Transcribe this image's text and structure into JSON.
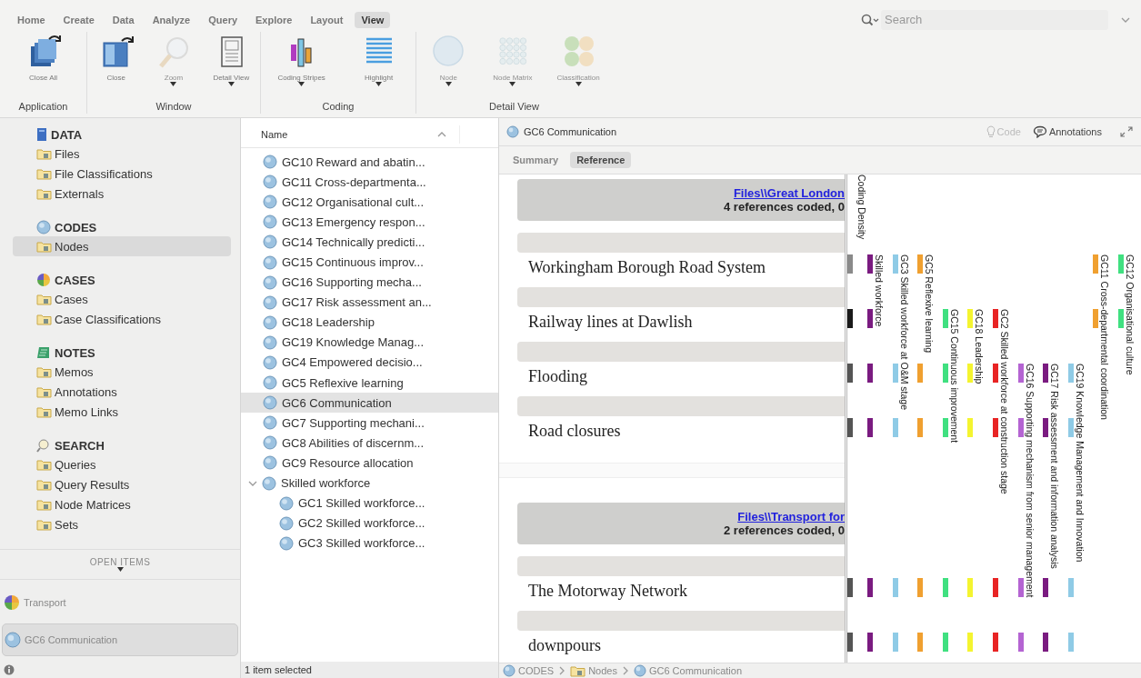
{
  "menu_tabs": [
    {
      "label": "Home",
      "selected": false
    },
    {
      "label": "Create",
      "selected": false
    },
    {
      "label": "Data",
      "selected": false
    },
    {
      "label": "Analyze",
      "selected": false
    },
    {
      "label": "Query",
      "selected": false
    },
    {
      "label": "Explore",
      "selected": false
    },
    {
      "label": "Layout",
      "selected": false
    },
    {
      "label": "View",
      "selected": true
    }
  ],
  "search": {
    "placeholder": "Search"
  },
  "ribbon_groups": [
    {
      "label": "Application",
      "buttons": [
        {
          "label": "Close All",
          "kind": "close-all",
          "disabled": false,
          "dropdown": false
        }
      ]
    },
    {
      "label": "Window",
      "buttons": [
        {
          "label": "Close",
          "kind": "close",
          "disabled": false,
          "dropdown": false
        },
        {
          "label": "Zoom",
          "kind": "zoom",
          "disabled": true,
          "dropdown": true
        },
        {
          "label": "Detail View",
          "kind": "detail-view",
          "disabled": false,
          "dropdown": true
        }
      ]
    },
    {
      "label": "Coding",
      "buttons": [
        {
          "label": "Coding Stripes",
          "kind": "coding-stripes",
          "disabled": false,
          "dropdown": true
        },
        {
          "label": "Highlight",
          "kind": "highlight",
          "disabled": false,
          "dropdown": true
        }
      ]
    },
    {
      "label": "Detail View",
      "buttons": [
        {
          "label": "Node",
          "kind": "node",
          "disabled": true,
          "dropdown": true
        },
        {
          "label": "Node Matrix",
          "kind": "node-matrix",
          "disabled": true,
          "dropdown": true
        },
        {
          "label": "Classification",
          "kind": "classification",
          "disabled": true,
          "dropdown": true
        }
      ]
    }
  ],
  "sidebar": {
    "sections": [
      {
        "label": "DATA",
        "kind": "data",
        "items": [
          {
            "label": "Files",
            "selected": false
          },
          {
            "label": "File Classifications",
            "selected": false
          },
          {
            "label": "Externals",
            "selected": false
          }
        ]
      },
      {
        "label": "CODES",
        "kind": "codes",
        "items": [
          {
            "label": "Nodes",
            "selected": true
          }
        ]
      },
      {
        "label": "CASES",
        "kind": "cases",
        "items": [
          {
            "label": "Cases",
            "selected": false
          },
          {
            "label": "Case Classifications",
            "selected": false
          }
        ]
      },
      {
        "label": "NOTES",
        "kind": "notes",
        "items": [
          {
            "label": "Memos",
            "selected": false
          },
          {
            "label": "Annotations",
            "selected": false
          },
          {
            "label": "Memo Links",
            "selected": false
          }
        ]
      },
      {
        "label": "SEARCH",
        "kind": "search",
        "items": [
          {
            "label": "Queries",
            "selected": false
          },
          {
            "label": "Query Results",
            "selected": false
          },
          {
            "label": "Node Matrices",
            "selected": false
          },
          {
            "label": "Sets",
            "selected": false
          }
        ]
      }
    ],
    "open_items": {
      "label": "OPEN ITEMS",
      "items": [
        {
          "label": "Transport",
          "kind": "case",
          "selected": false
        },
        {
          "label": "GC6 Communication",
          "kind": "node",
          "selected": true
        }
      ]
    }
  },
  "node_list": {
    "column": "Name",
    "items": [
      {
        "label": "GC10 Reward and abatin...",
        "selected": false
      },
      {
        "label": "GC11 Cross-departmenta...",
        "selected": false
      },
      {
        "label": "GC12 Organisational cult...",
        "selected": false
      },
      {
        "label": "GC13 Emergency respon...",
        "selected": false
      },
      {
        "label": "GC14 Technically predicti...",
        "selected": false
      },
      {
        "label": "GC15 Continuous improv...",
        "selected": false
      },
      {
        "label": "GC16 Supporting mecha...",
        "selected": false
      },
      {
        "label": "GC17 Risk assessment an...",
        "selected": false
      },
      {
        "label": "GC18 Leadership",
        "selected": false
      },
      {
        "label": "GC19 Knowledge Manag...",
        "selected": false
      },
      {
        "label": "GC4 Empowered decisio...",
        "selected": false
      },
      {
        "label": "GC5 Reflexive learning",
        "selected": false
      },
      {
        "label": "GC6 Communication",
        "selected": true
      },
      {
        "label": "GC7 Supporting mechani...",
        "selected": false
      },
      {
        "label": "GC8 Abilities of discernm...",
        "selected": false
      },
      {
        "label": "GC9 Resource allocation",
        "selected": false
      },
      {
        "label": "Skilled workforce",
        "selected": false,
        "expanded": true,
        "children": [
          {
            "label": "GC1 Skilled workforce...",
            "selected": false
          },
          {
            "label": "GC2 Skilled workforce...",
            "selected": false
          },
          {
            "label": "GC3 Skilled workforce...",
            "selected": false
          }
        ]
      }
    ],
    "status": "1 item selected"
  },
  "detail": {
    "title": "GC6 Communication",
    "header_buttons": [
      {
        "label": "Code",
        "kind": "code",
        "disabled": true
      },
      {
        "label": "Annotations",
        "kind": "annotations",
        "disabled": false
      }
    ],
    "tabs": [
      {
        "label": "Summary",
        "selected": false
      },
      {
        "label": "Reference",
        "selected": true
      }
    ],
    "cards": [
      {
        "link": "Files\\\\Great London",
        "summary": "4 references coded, 0",
        "references": [
          "Workingham Borough Road System",
          "Railway lines at Dawlish",
          "Flooding",
          "Road closures"
        ]
      },
      {
        "link": "Files\\\\Transport for",
        "summary": "2 references coded, 0",
        "references": [
          "The Motorway Network",
          "downpours"
        ]
      }
    ],
    "coding_stripes": {
      "density_label": "Coding Density",
      "density": [
        {
          "color": "#8a8a8a"
        },
        {
          "color": "#1a1a1a"
        },
        {
          "color": "#555555"
        },
        {
          "color": "#555555"
        },
        {
          "color": "#555555"
        },
        {
          "color": "#555555"
        }
      ],
      "stripes": [
        {
          "label": "Skilled workforce",
          "color": "#7a1b80",
          "coded": [
            true,
            true,
            true,
            true,
            true,
            true
          ]
        },
        {
          "label": "GC3 Skilled workforce at O&M stage",
          "color": "#8fcbe6",
          "coded": [
            true,
            false,
            true,
            true,
            true,
            true
          ]
        },
        {
          "label": "GC5 Reflexive learning",
          "color": "#f0a030",
          "coded": [
            true,
            false,
            true,
            true,
            true,
            true
          ]
        },
        {
          "label": "GC15 Continuous improvement",
          "color": "#40e080",
          "coded": [
            false,
            true,
            true,
            true,
            true,
            true
          ]
        },
        {
          "label": "GC18 Leadership",
          "color": "#f4f430",
          "coded": [
            false,
            true,
            true,
            true,
            true,
            true
          ]
        },
        {
          "label": "GC2 Skilled workforce at construction stage",
          "color": "#e82424",
          "coded": [
            false,
            true,
            true,
            true,
            true,
            true
          ]
        },
        {
          "label": "GC16 Supporting mechanism from senior management",
          "color": "#b464d2",
          "coded": [
            false,
            false,
            true,
            true,
            true,
            true
          ]
        },
        {
          "label": "GC17 Risk assessment and information analysis",
          "color": "#7a1b80",
          "coded": [
            false,
            false,
            true,
            true,
            true,
            true
          ]
        },
        {
          "label": "GC19 Knowledge Management and Innovation",
          "color": "#8fcbe6",
          "coded": [
            false,
            false,
            true,
            true,
            true,
            true
          ]
        },
        {
          "label": "GC11 Cross-departmental coordination",
          "color": "#f0a030",
          "coded": [
            true,
            true,
            false,
            false,
            false,
            false
          ]
        },
        {
          "label": "GC12 Organisational culture",
          "color": "#40e080",
          "coded": [
            true,
            true,
            false,
            false,
            false,
            false
          ]
        }
      ]
    },
    "breadcrumb": [
      {
        "label": "CODES",
        "kind": "node"
      },
      {
        "label": "Nodes",
        "kind": "folder"
      },
      {
        "label": "GC6 Communication",
        "kind": "node"
      }
    ]
  }
}
